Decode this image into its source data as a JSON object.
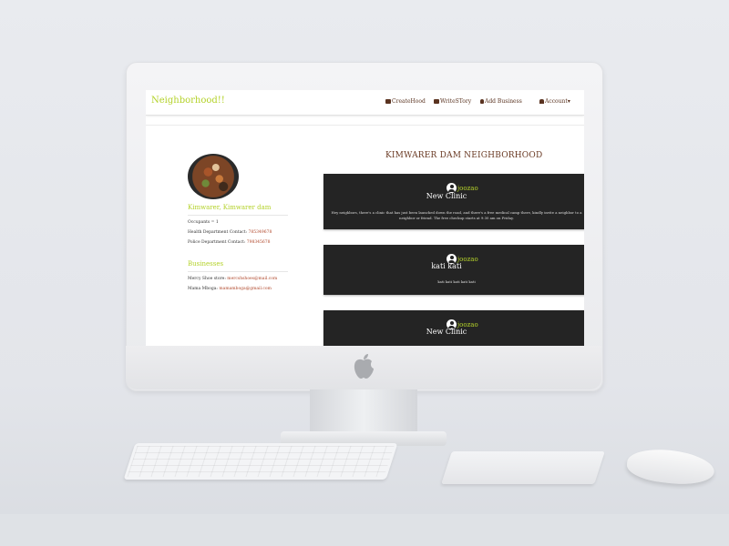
{
  "navbar": {
    "brand": "Neighborhood!!",
    "items": [
      {
        "label": "CreateHood",
        "icon": "group-icon"
      },
      {
        "label": "WriteSTory",
        "icon": "book-icon"
      },
      {
        "label": "Add Business",
        "icon": "bell-icon"
      },
      {
        "label": "Account",
        "icon": "user-icon"
      }
    ],
    "account_caret": "▾"
  },
  "sidebar": {
    "place": "Kimwarer, Kimwarer dam",
    "occupants_label": "Occupants = 1",
    "health_label": "Health Department Contact:",
    "health_value": "785349678",
    "police_label": "Police Department Contact:",
    "police_value": "798345678",
    "businesses_title": "Businesses",
    "businesses": [
      {
        "label": "Mercy Shoe store:",
        "email": "mercshshoes@mail.com"
      },
      {
        "label": "Mama Mboga:",
        "email": "mamamboga@gmail.com"
      }
    ]
  },
  "main": {
    "title": "KIMWARER DAM NEIGHBORHOOD",
    "stories": [
      {
        "author": "joozao",
        "title": "New Clinic",
        "body": "Hey neighbors, there's a clinic that has just been launched down the road, and there's a free medical camp there, kindly invite a neighbor to a neighbor or friend. The free checkup starts at 9:30 am on Friday."
      },
      {
        "author": "joozao",
        "title": "kati kati",
        "body": "kati kati kati kati kati"
      },
      {
        "author": "joozao",
        "title": "New Clinic",
        "body": ""
      }
    ]
  },
  "colors": {
    "brand": "#b4d22a",
    "link": "#b0472a",
    "nav_text": "#5a3320",
    "card_bg": "#242424"
  }
}
